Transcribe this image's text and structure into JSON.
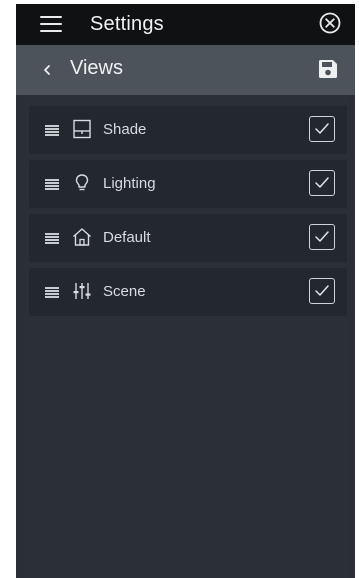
{
  "topbar": {
    "title": "Settings",
    "menu_icon": "hamburger-icon",
    "close_icon": "close-circle-icon"
  },
  "subheader": {
    "title": "Views",
    "back_icon": "chevron-left-icon",
    "save_icon": "save-icon"
  },
  "views": [
    {
      "label": "Shade",
      "icon": "shade-icon",
      "checked": true
    },
    {
      "label": "Lighting",
      "icon": "lightbulb-icon",
      "checked": true
    },
    {
      "label": "Default",
      "icon": "home-icon",
      "checked": true
    },
    {
      "label": "Scene",
      "icon": "sliders-icon",
      "checked": true
    }
  ],
  "colors": {
    "topbar_bg": "#0f1113",
    "subheader_bg": "#4d535a",
    "content_bg": "#2b3038",
    "item_bg": "#222730",
    "text": "#d8dce0"
  }
}
